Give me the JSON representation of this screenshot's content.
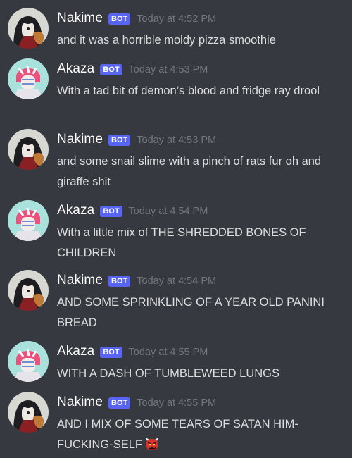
{
  "bot_tag": "BOT",
  "colors": {
    "background": "#36393f",
    "username": "#ffffff",
    "timestamp": "#72767d",
    "message_text": "#dcddde",
    "bot_tag_bg": "#5865f2"
  },
  "messages": [
    {
      "author": "Nakime",
      "avatar": "nakime-avatar",
      "timestamp": "Today at 4:52 PM",
      "text": "and it was a horrible moldy pizza smoothie"
    },
    {
      "author": "Akaza",
      "avatar": "akaza-avatar",
      "timestamp": "Today at 4:53 PM",
      "text": "With a tad bit of demon’s blood and fridge ray drool"
    },
    {
      "author": "Nakime",
      "avatar": "nakime-avatar",
      "timestamp": "Today at 4:53 PM",
      "text": "and some snail slime with a pinch of rats fur oh and giraffe shit"
    },
    {
      "author": "Akaza",
      "avatar": "akaza-avatar",
      "timestamp": "Today at 4:54 PM",
      "text": "With a little mix of THE SHREDDED BONES OF CHILDREN"
    },
    {
      "author": "Nakime",
      "avatar": "nakime-avatar",
      "timestamp": "Today at 4:54 PM",
      "text": "AND SOME SPRINKLING OF A YEAR OLD PANINI BREAD"
    },
    {
      "author": "Akaza",
      "avatar": "akaza-avatar",
      "timestamp": "Today at 4:55 PM",
      "text": "WITH A DASH OF TUMBLEWEED LUNGS"
    },
    {
      "author": "Nakime",
      "avatar": "nakime-avatar",
      "timestamp": "Today at 4:55 PM",
      "text": "AND I MIX OF SOME TEARS OF SATAN HIM-FUCKING-SELF",
      "emoji": "ogre-emoji"
    }
  ]
}
